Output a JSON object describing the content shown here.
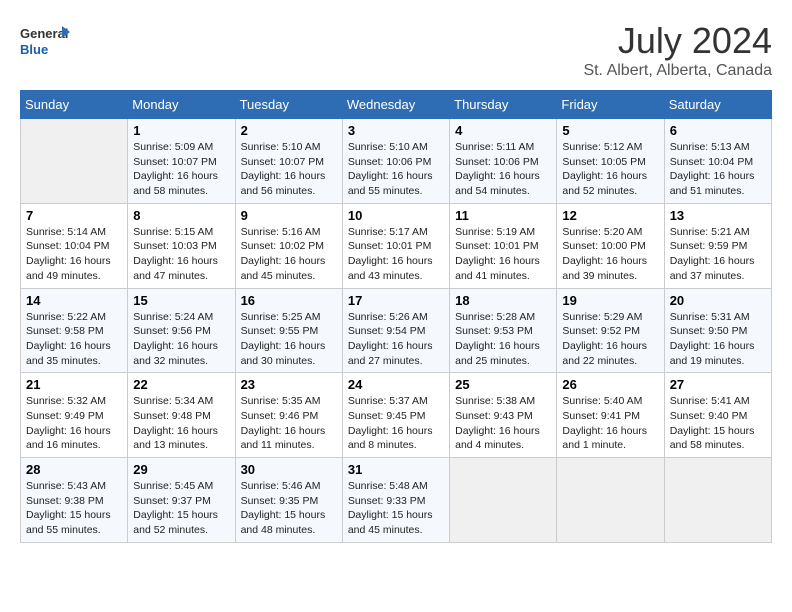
{
  "header": {
    "logo_line1": "General",
    "logo_line2": "Blue",
    "month": "July 2024",
    "location": "St. Albert, Alberta, Canada"
  },
  "weekdays": [
    "Sunday",
    "Monday",
    "Tuesday",
    "Wednesday",
    "Thursday",
    "Friday",
    "Saturday"
  ],
  "weeks": [
    [
      {
        "day": "",
        "info": ""
      },
      {
        "day": "1",
        "info": "Sunrise: 5:09 AM\nSunset: 10:07 PM\nDaylight: 16 hours\nand 58 minutes."
      },
      {
        "day": "2",
        "info": "Sunrise: 5:10 AM\nSunset: 10:07 PM\nDaylight: 16 hours\nand 56 minutes."
      },
      {
        "day": "3",
        "info": "Sunrise: 5:10 AM\nSunset: 10:06 PM\nDaylight: 16 hours\nand 55 minutes."
      },
      {
        "day": "4",
        "info": "Sunrise: 5:11 AM\nSunset: 10:06 PM\nDaylight: 16 hours\nand 54 minutes."
      },
      {
        "day": "5",
        "info": "Sunrise: 5:12 AM\nSunset: 10:05 PM\nDaylight: 16 hours\nand 52 minutes."
      },
      {
        "day": "6",
        "info": "Sunrise: 5:13 AM\nSunset: 10:04 PM\nDaylight: 16 hours\nand 51 minutes."
      }
    ],
    [
      {
        "day": "7",
        "info": "Sunrise: 5:14 AM\nSunset: 10:04 PM\nDaylight: 16 hours\nand 49 minutes."
      },
      {
        "day": "8",
        "info": "Sunrise: 5:15 AM\nSunset: 10:03 PM\nDaylight: 16 hours\nand 47 minutes."
      },
      {
        "day": "9",
        "info": "Sunrise: 5:16 AM\nSunset: 10:02 PM\nDaylight: 16 hours\nand 45 minutes."
      },
      {
        "day": "10",
        "info": "Sunrise: 5:17 AM\nSunset: 10:01 PM\nDaylight: 16 hours\nand 43 minutes."
      },
      {
        "day": "11",
        "info": "Sunrise: 5:19 AM\nSunset: 10:01 PM\nDaylight: 16 hours\nand 41 minutes."
      },
      {
        "day": "12",
        "info": "Sunrise: 5:20 AM\nSunset: 10:00 PM\nDaylight: 16 hours\nand 39 minutes."
      },
      {
        "day": "13",
        "info": "Sunrise: 5:21 AM\nSunset: 9:59 PM\nDaylight: 16 hours\nand 37 minutes."
      }
    ],
    [
      {
        "day": "14",
        "info": "Sunrise: 5:22 AM\nSunset: 9:58 PM\nDaylight: 16 hours\nand 35 minutes."
      },
      {
        "day": "15",
        "info": "Sunrise: 5:24 AM\nSunset: 9:56 PM\nDaylight: 16 hours\nand 32 minutes."
      },
      {
        "day": "16",
        "info": "Sunrise: 5:25 AM\nSunset: 9:55 PM\nDaylight: 16 hours\nand 30 minutes."
      },
      {
        "day": "17",
        "info": "Sunrise: 5:26 AM\nSunset: 9:54 PM\nDaylight: 16 hours\nand 27 minutes."
      },
      {
        "day": "18",
        "info": "Sunrise: 5:28 AM\nSunset: 9:53 PM\nDaylight: 16 hours\nand 25 minutes."
      },
      {
        "day": "19",
        "info": "Sunrise: 5:29 AM\nSunset: 9:52 PM\nDaylight: 16 hours\nand 22 minutes."
      },
      {
        "day": "20",
        "info": "Sunrise: 5:31 AM\nSunset: 9:50 PM\nDaylight: 16 hours\nand 19 minutes."
      }
    ],
    [
      {
        "day": "21",
        "info": "Sunrise: 5:32 AM\nSunset: 9:49 PM\nDaylight: 16 hours\nand 16 minutes."
      },
      {
        "day": "22",
        "info": "Sunrise: 5:34 AM\nSunset: 9:48 PM\nDaylight: 16 hours\nand 13 minutes."
      },
      {
        "day": "23",
        "info": "Sunrise: 5:35 AM\nSunset: 9:46 PM\nDaylight: 16 hours\nand 11 minutes."
      },
      {
        "day": "24",
        "info": "Sunrise: 5:37 AM\nSunset: 9:45 PM\nDaylight: 16 hours\nand 8 minutes."
      },
      {
        "day": "25",
        "info": "Sunrise: 5:38 AM\nSunset: 9:43 PM\nDaylight: 16 hours\nand 4 minutes."
      },
      {
        "day": "26",
        "info": "Sunrise: 5:40 AM\nSunset: 9:41 PM\nDaylight: 16 hours\nand 1 minute."
      },
      {
        "day": "27",
        "info": "Sunrise: 5:41 AM\nSunset: 9:40 PM\nDaylight: 15 hours\nand 58 minutes."
      }
    ],
    [
      {
        "day": "28",
        "info": "Sunrise: 5:43 AM\nSunset: 9:38 PM\nDaylight: 15 hours\nand 55 minutes."
      },
      {
        "day": "29",
        "info": "Sunrise: 5:45 AM\nSunset: 9:37 PM\nDaylight: 15 hours\nand 52 minutes."
      },
      {
        "day": "30",
        "info": "Sunrise: 5:46 AM\nSunset: 9:35 PM\nDaylight: 15 hours\nand 48 minutes."
      },
      {
        "day": "31",
        "info": "Sunrise: 5:48 AM\nSunset: 9:33 PM\nDaylight: 15 hours\nand 45 minutes."
      },
      {
        "day": "",
        "info": ""
      },
      {
        "day": "",
        "info": ""
      },
      {
        "day": "",
        "info": ""
      }
    ]
  ]
}
